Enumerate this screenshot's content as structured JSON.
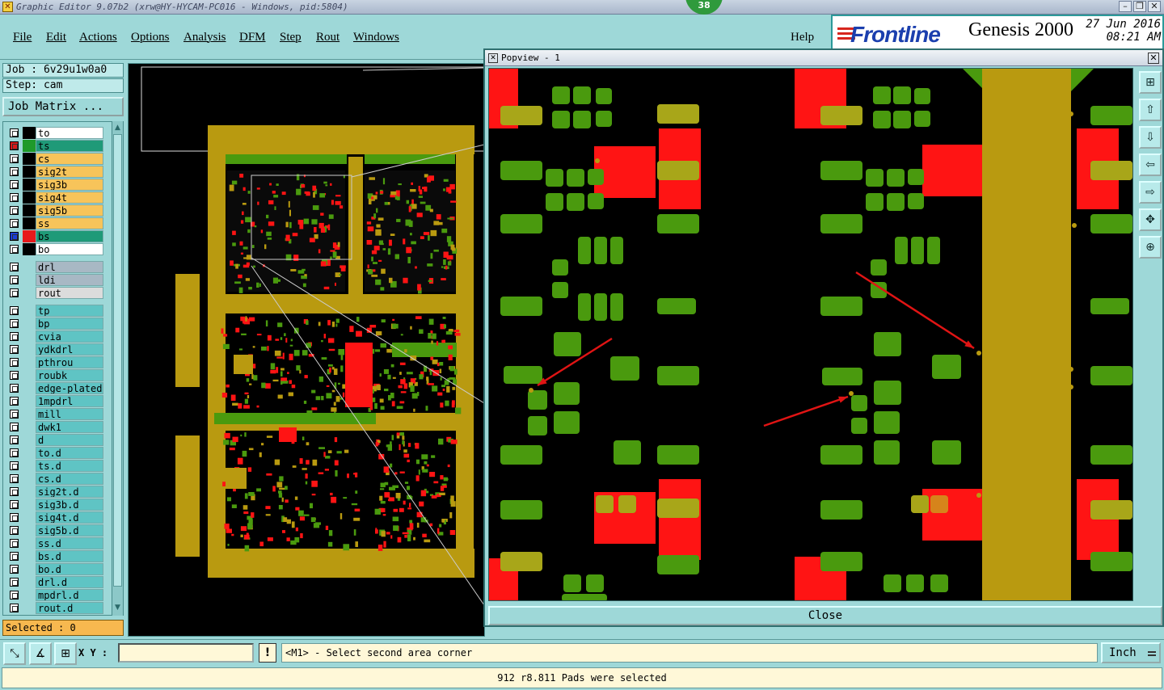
{
  "window": {
    "title": "Graphic Editor 9.07b2 (xrw@HY-HYCAM-PC016 - Windows, pid:5804)",
    "badge": "38"
  },
  "menu": [
    "File",
    "Edit",
    "Actions",
    "Options",
    "Analysis",
    "DFM",
    "Step",
    "Rout",
    "Windows"
  ],
  "help": "Help",
  "brand": {
    "logo": "Frontline",
    "product": "Genesis 2000",
    "date": "27 Jun 2016",
    "time": "08:21 AM"
  },
  "job": {
    "label": "Job : 6v29u1w0a0",
    "step": "Step: cam",
    "matrix_button": "Job Matrix ..."
  },
  "layers": {
    "board": [
      {
        "name": "to",
        "color": "#ffffff",
        "swatch": "#000000",
        "state": "off"
      },
      {
        "name": "ts",
        "color": "#1f9a78",
        "swatch": "#1f9a2a",
        "state": "work"
      },
      {
        "name": "cs",
        "color": "#f7c45a",
        "swatch": "#000000",
        "state": "off"
      },
      {
        "name": "sig2t",
        "color": "#f7c45a",
        "swatch": "#000000",
        "state": "off"
      },
      {
        "name": "sig3b",
        "color": "#f7c45a",
        "swatch": "#000000",
        "state": "off"
      },
      {
        "name": "sig4t",
        "color": "#f7c45a",
        "swatch": "#000000",
        "state": "off"
      },
      {
        "name": "sig5b",
        "color": "#f7c45a",
        "swatch": "#000000",
        "state": "off"
      },
      {
        "name": "ss",
        "color": "#f7c45a",
        "swatch": "#000000",
        "state": "off"
      },
      {
        "name": "bs",
        "color": "#1f9a78",
        "swatch": "#e8191b",
        "state": "affected"
      },
      {
        "name": "bo",
        "color": "#ffffff",
        "swatch": "#000000",
        "state": "off"
      }
    ],
    "drill": [
      {
        "name": "drl",
        "color": "#a8b8c4"
      },
      {
        "name": "ldi",
        "color": "#a8b8c4"
      },
      {
        "name": "rout",
        "color": "#dcdcdc"
      }
    ],
    "misc": [
      "tp",
      "bp",
      "cvia",
      "ydkdrl",
      "pthrou",
      "roubk",
      "edge-plated",
      "1mpdrl",
      "mill",
      "dwk1",
      "d",
      "to.d",
      "ts.d",
      "cs.d",
      "sig2t.d",
      "sig3b.d",
      "sig4t.d",
      "sig5b.d",
      "ss.d",
      "bs.d",
      "bo.d",
      "drl.d",
      "mpdrl.d",
      "rout.d"
    ]
  },
  "selected": "Selected : 0",
  "popview": {
    "title": "Popview - 1",
    "close": "Close"
  },
  "bottom": {
    "xy_label": "X Y :",
    "xy_value": "",
    "prompt": "<M1> - Select second area corner",
    "unit": "Inch",
    "status": "912 r8.811 Pads were selected"
  },
  "colors": {
    "pad_green": "#4a9a0e",
    "copper": "#b99a10",
    "red": "#ff1414",
    "bg": "#9ed8d8"
  }
}
